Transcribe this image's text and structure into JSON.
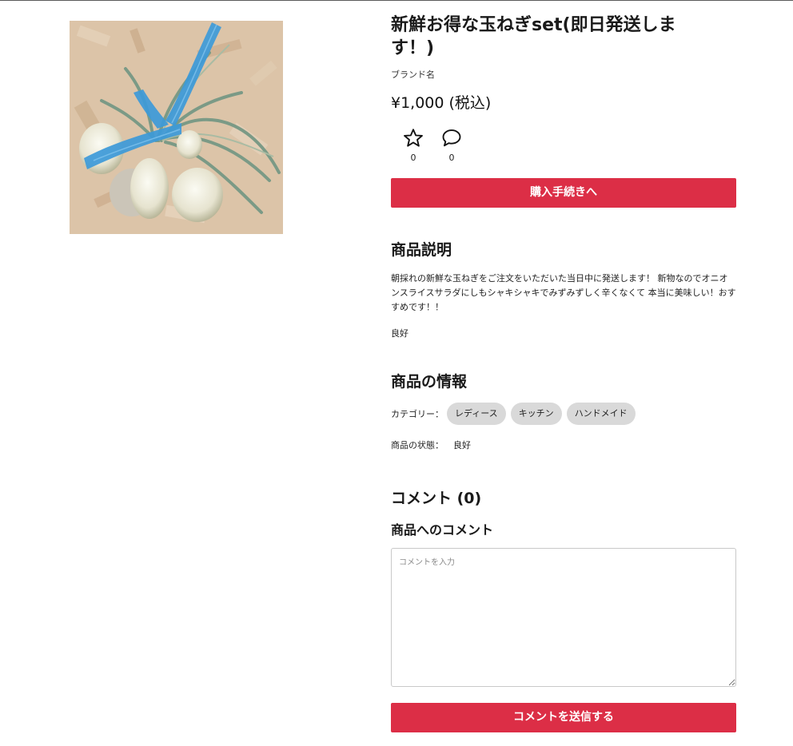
{
  "product": {
    "title": "新鮮お得な玉ねぎset(即日発送します！)",
    "brand": "ブランド名",
    "price": "¥1,000 (税込)",
    "favorites_count": "0",
    "comments_count": "0",
    "buy_label": "購入手続きへ"
  },
  "description": {
    "heading": "商品説明",
    "body": "朝採れの新鮮な玉ねぎをご注文をいただいた当日中に発送します！ 新物なのでオニオンスライスサラダにしもシャキシャキでみずみずしく辛くなくて 本当に美味しい！おすすめです！！",
    "condition": "良好"
  },
  "info": {
    "heading": "商品の情報",
    "category_label": "カテゴリー：",
    "categories": [
      "レディース",
      "キッチン",
      "ハンドメイド"
    ],
    "state_label": "商品の状態：",
    "state_value": "良好"
  },
  "comments": {
    "heading": "コメント (0)",
    "subheading": "商品へのコメント",
    "placeholder": "コメントを入力",
    "submit_label": "コメントを送信する"
  },
  "icons": {
    "favorite": "star-icon",
    "comment": "speech-bubble-icon"
  },
  "colors": {
    "accent": "#dc2e46",
    "chip_bg": "#d9d9d9"
  }
}
